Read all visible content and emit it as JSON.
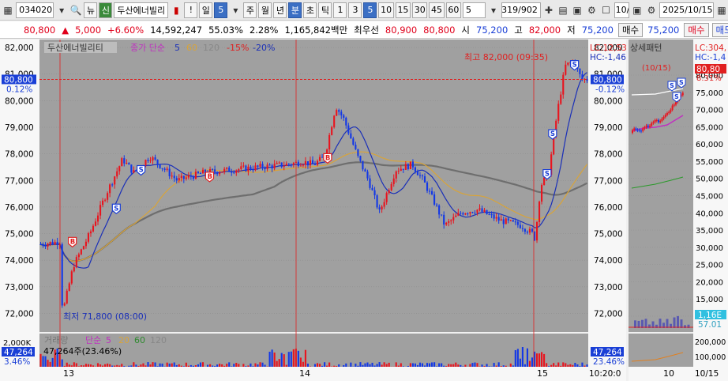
{
  "toolbar": {
    "code": "034020",
    "market_btn": "뉴",
    "credit_btn": "신",
    "stock_name": "두산에너빌리",
    "warn": "!",
    "period_label": "일",
    "period_value": "5",
    "btn_week": "주",
    "btn_month": "월",
    "btn_year": "년",
    "btn_min": "분",
    "btn_sec": "초",
    "btn_tick": "틱",
    "intervals": [
      "1",
      "3",
      "5",
      "10",
      "15",
      "30",
      "45",
      "60"
    ],
    "custom_value": "5",
    "counter": "319/902",
    "right_value": "10/",
    "date": "2025/10/15"
  },
  "quote": {
    "price": "80,800",
    "change": "5,000",
    "change_pct": "+6.60%",
    "volume": "14,592,247",
    "vol_ratio": "55.03%",
    "turnover_pct": "2.28%",
    "amount": "1,165,842백만",
    "best_bid_label": "최우선",
    "best_ask": "80,900",
    "best_bid": "80,800",
    "open_label": "시",
    "open": "75,200",
    "high_label": "고",
    "high": "82,000",
    "low_label": "저",
    "low": "75,200",
    "buy_label": "매수",
    "side_price": "75,200",
    "buy_label2": "매수",
    "sell_label": "매도"
  },
  "legend": {
    "name": "두산에너빌리티",
    "ma_label": "종가 단순",
    "ma5": "5",
    "ma60": "60",
    "ma120": "120",
    "env_minus15": "-15%",
    "env_minus20": "-20%"
  },
  "chart_data": {
    "type": "candlestick",
    "y_ticks": [
      "82,000",
      "81,000",
      "80,000",
      "79,000",
      "78,000",
      "77,000",
      "76,000",
      "75,000",
      "74,000",
      "73,000",
      "72,000"
    ],
    "ylim": [
      71300,
      82300
    ],
    "current_price_label": "80,800",
    "current_pct_label": "0.12%",
    "current_pct_label_right": "-0.12%",
    "lc_label": "LC:12,53",
    "hc_label": "HC:-1,46",
    "high_annotation": "최고 82,000 (09:35)",
    "low_annotation": "최저 71,800 (08:00)",
    "x_labels": [
      "13",
      "14",
      "15"
    ],
    "time_label": "10:20:0",
    "volume_legend": {
      "label": "거래량",
      "ma_label": "단순",
      "ma5": "5",
      "ma20": "20",
      "ma60": "60",
      "ma120": "120"
    },
    "volume_value": "47,264",
    "volume_detail": "47,264주(23.46%)",
    "volume_y_tick": "2,000K",
    "volume_left_badge": "47,264",
    "volume_left_pct": "3.46%",
    "volume_right_badge": "47,264",
    "volume_right_pct": "23.46%",
    "signals": [
      {
        "type": "B",
        "x": 0.06,
        "price": 74650
      },
      {
        "type": "S",
        "x": 0.14,
        "price": 75900
      },
      {
        "type": "S",
        "x": 0.185,
        "price": 77350
      },
      {
        "type": "B",
        "x": 0.525,
        "price": 77800
      },
      {
        "type": "B",
        "x": 0.31,
        "price": 77100
      },
      {
        "type": "S",
        "x": 0.925,
        "price": 77200
      },
      {
        "type": "S",
        "x": 0.935,
        "price": 78700
      },
      {
        "type": "S",
        "x": 0.975,
        "price": 81300
      }
    ]
  },
  "side_panel": {
    "title": "상세패턴",
    "lc_label": "LC:304,",
    "hc_label": "HC:-1,4",
    "annotation": "(10/15)",
    "price_badge": "80,80",
    "pct_label": "8.31%",
    "y_ticks": [
      "80,000",
      "75,000",
      "70,000",
      "65,000",
      "60,000",
      "55,000",
      "50,000",
      "45,000",
      "40,000",
      "35,000",
      "30,000",
      "25,000",
      "20,000",
      "15,000",
      "10,000"
    ],
    "vol_badge": "1,16E",
    "vol_pct": "57.01",
    "vol_y_ticks": [
      "200,000",
      "100,000"
    ],
    "x_label": "10",
    "x_right": "10/15"
  },
  "colors": {
    "up": "#e8141e",
    "down": "#1338e6",
    "chart_bg": "#a0a0a0",
    "ma5": "#1a2fb8",
    "ma20": "#d8a43a",
    "ma60": "#6e6e6e",
    "grid": "#8a8a8a"
  }
}
